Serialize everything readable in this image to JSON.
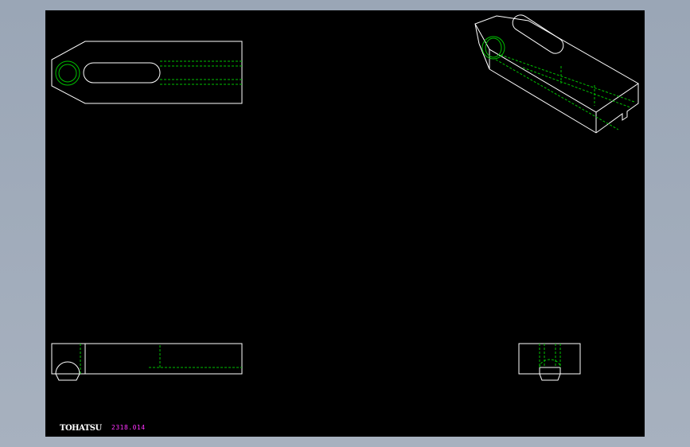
{
  "logo_text": "TOHATSU",
  "part_number": "2318.014",
  "colors": {
    "background": "#000000",
    "outline": "#ffffff",
    "hidden_line": "#00c000",
    "part_number": "#ff33ff"
  }
}
